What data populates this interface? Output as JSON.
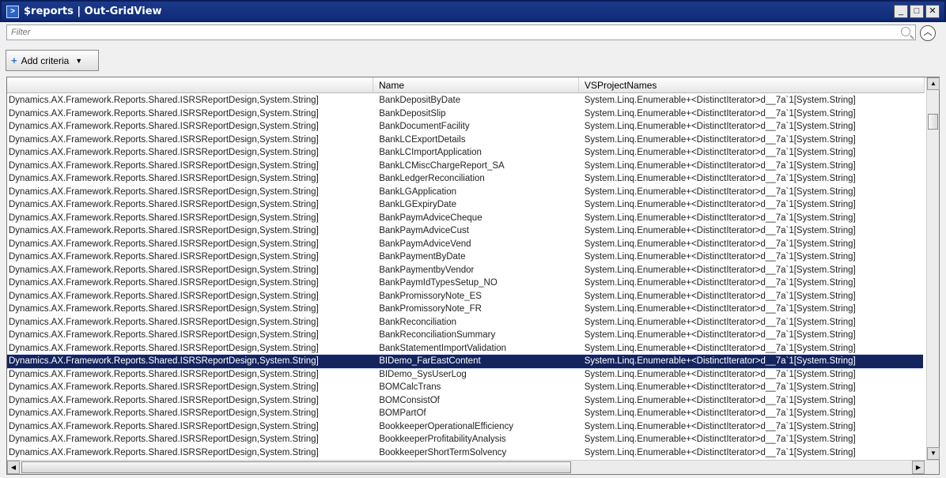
{
  "window": {
    "title": "$reports | Out-GridView",
    "app_icon": "powershell-icon",
    "buttons": {
      "minimize": "_",
      "maximize": "□",
      "close": "✕"
    }
  },
  "filter": {
    "placeholder": "Filter",
    "value": ""
  },
  "toolbar": {
    "add_criteria_label": "Add criteria",
    "add_icon": "+",
    "caret_icon": "▼"
  },
  "grid": {
    "columns": [
      "",
      "Name",
      "VSProjectNames"
    ],
    "rows": [
      [
        "Dynamics.AX.Framework.Reports.Shared.ISRSReportDesign,System.String]",
        "BankDepositByDate",
        "System.Linq.Enumerable+<DistinctIterator>d__7a`1[System.String]"
      ],
      [
        "Dynamics.AX.Framework.Reports.Shared.ISRSReportDesign,System.String]",
        "BankDepositSlip",
        "System.Linq.Enumerable+<DistinctIterator>d__7a`1[System.String]"
      ],
      [
        "Dynamics.AX.Framework.Reports.Shared.ISRSReportDesign,System.String]",
        "BankDocumentFacility",
        "System.Linq.Enumerable+<DistinctIterator>d__7a`1[System.String]"
      ],
      [
        "Dynamics.AX.Framework.Reports.Shared.ISRSReportDesign,System.String]",
        "BankLCExportDetails",
        "System.Linq.Enumerable+<DistinctIterator>d__7a`1[System.String]"
      ],
      [
        "Dynamics.AX.Framework.Reports.Shared.ISRSReportDesign,System.String]",
        "BankLCImportApplication",
        "System.Linq.Enumerable+<DistinctIterator>d__7a`1[System.String]"
      ],
      [
        "Dynamics.AX.Framework.Reports.Shared.ISRSReportDesign,System.String]",
        "BankLCMiscChargeReport_SA",
        "System.Linq.Enumerable+<DistinctIterator>d__7a`1[System.String]"
      ],
      [
        "Dynamics.AX.Framework.Reports.Shared.ISRSReportDesign,System.String]",
        "BankLedgerReconciliation",
        "System.Linq.Enumerable+<DistinctIterator>d__7a`1[System.String]"
      ],
      [
        "Dynamics.AX.Framework.Reports.Shared.ISRSReportDesign,System.String]",
        "BankLGApplication",
        "System.Linq.Enumerable+<DistinctIterator>d__7a`1[System.String]"
      ],
      [
        "Dynamics.AX.Framework.Reports.Shared.ISRSReportDesign,System.String]",
        "BankLGExpiryDate",
        "System.Linq.Enumerable+<DistinctIterator>d__7a`1[System.String]"
      ],
      [
        "Dynamics.AX.Framework.Reports.Shared.ISRSReportDesign,System.String]",
        "BankPaymAdviceCheque",
        "System.Linq.Enumerable+<DistinctIterator>d__7a`1[System.String]"
      ],
      [
        "Dynamics.AX.Framework.Reports.Shared.ISRSReportDesign,System.String]",
        "BankPaymAdviceCust",
        "System.Linq.Enumerable+<DistinctIterator>d__7a`1[System.String]"
      ],
      [
        "Dynamics.AX.Framework.Reports.Shared.ISRSReportDesign,System.String]",
        "BankPaymAdviceVend",
        "System.Linq.Enumerable+<DistinctIterator>d__7a`1[System.String]"
      ],
      [
        "Dynamics.AX.Framework.Reports.Shared.ISRSReportDesign,System.String]",
        "BankPaymentByDate",
        "System.Linq.Enumerable+<DistinctIterator>d__7a`1[System.String]"
      ],
      [
        "Dynamics.AX.Framework.Reports.Shared.ISRSReportDesign,System.String]",
        "BankPaymentbyVendor",
        "System.Linq.Enumerable+<DistinctIterator>d__7a`1[System.String]"
      ],
      [
        "Dynamics.AX.Framework.Reports.Shared.ISRSReportDesign,System.String]",
        "BankPaymIdTypesSetup_NO",
        "System.Linq.Enumerable+<DistinctIterator>d__7a`1[System.String]"
      ],
      [
        "Dynamics.AX.Framework.Reports.Shared.ISRSReportDesign,System.String]",
        "BankPromissoryNote_ES",
        "System.Linq.Enumerable+<DistinctIterator>d__7a`1[System.String]"
      ],
      [
        "Dynamics.AX.Framework.Reports.Shared.ISRSReportDesign,System.String]",
        "BankPromissoryNote_FR",
        "System.Linq.Enumerable+<DistinctIterator>d__7a`1[System.String]"
      ],
      [
        "Dynamics.AX.Framework.Reports.Shared.ISRSReportDesign,System.String]",
        "BankReconciliation",
        "System.Linq.Enumerable+<DistinctIterator>d__7a`1[System.String]"
      ],
      [
        "Dynamics.AX.Framework.Reports.Shared.ISRSReportDesign,System.String]",
        "BankReconciliationSummary",
        "System.Linq.Enumerable+<DistinctIterator>d__7a`1[System.String]"
      ],
      [
        "Dynamics.AX.Framework.Reports.Shared.ISRSReportDesign,System.String]",
        "BankStatementImportValidation",
        "System.Linq.Enumerable+<DistinctIterator>d__7a`1[System.String]"
      ],
      [
        "Dynamics.AX.Framework.Reports.Shared.ISRSReportDesign,System.String]",
        "BIDemo_FarEastContent",
        "System.Linq.Enumerable+<DistinctIterator>d__7a`1[System.String]"
      ],
      [
        "Dynamics.AX.Framework.Reports.Shared.ISRSReportDesign,System.String]",
        "BIDemo_SysUserLog",
        "System.Linq.Enumerable+<DistinctIterator>d__7a`1[System.String]"
      ],
      [
        "Dynamics.AX.Framework.Reports.Shared.ISRSReportDesign,System.String]",
        "BOMCalcTrans",
        "System.Linq.Enumerable+<DistinctIterator>d__7a`1[System.String]"
      ],
      [
        "Dynamics.AX.Framework.Reports.Shared.ISRSReportDesign,System.String]",
        "BOMConsistOf",
        "System.Linq.Enumerable+<DistinctIterator>d__7a`1[System.String]"
      ],
      [
        "Dynamics.AX.Framework.Reports.Shared.ISRSReportDesign,System.String]",
        "BOMPartOf",
        "System.Linq.Enumerable+<DistinctIterator>d__7a`1[System.String]"
      ],
      [
        "Dynamics.AX.Framework.Reports.Shared.ISRSReportDesign,System.String]",
        "BookkeeperOperationalEfficiency",
        "System.Linq.Enumerable+<DistinctIterator>d__7a`1[System.String]"
      ],
      [
        "Dynamics.AX.Framework.Reports.Shared.ISRSReportDesign,System.String]",
        "BookkeeperProfitabilityAnalysis",
        "System.Linq.Enumerable+<DistinctIterator>d__7a`1[System.String]"
      ],
      [
        "Dynamics.AX.Framework.Reports.Shared.ISRSReportDesign,System.String]",
        "BookkeeperShortTermSolvency",
        "System.Linq.Enumerable+<DistinctIterator>d__7a`1[System.String]"
      ]
    ],
    "selected_row": 20
  },
  "colors": {
    "titlebar": "#0f2a78",
    "selection": "#14245e",
    "selection_text": "#ffffff"
  },
  "icons": {
    "search": "search-icon",
    "collapse": "chevron-up-icon"
  }
}
